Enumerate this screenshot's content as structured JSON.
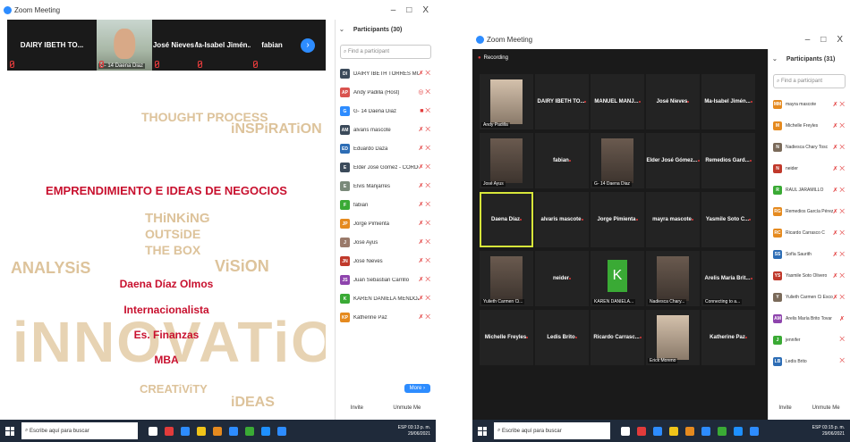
{
  "window_title": "Zoom Meeting",
  "window_controls": [
    "–",
    "□",
    "X"
  ],
  "shot1": {
    "strip": {
      "tiles": [
        {
          "name": "DAIRY IBETH TO...",
          "video": false
        },
        {
          "name": "G- 14 Daena Diaz",
          "video": true
        },
        {
          "name": "José Nieves",
          "video": false
        },
        {
          "name": "Ma-Isabel Jimén...",
          "video": false
        },
        {
          "name": "fabian",
          "video": false
        }
      ],
      "next_icon": "›"
    },
    "slide": {
      "doodles": [
        "THOUGHT PROCESS",
        "iNSPiRATiON",
        "THiNKiNG",
        "OUTSiDE",
        "THE BOX",
        "ANALYSiS",
        "ViSiON",
        "iNNOVATiON",
        "CREATiViTY",
        "iDEAS"
      ],
      "title": "EMPRENDIMIENTO E IDEAS DE NEGOCIOS",
      "lines": [
        "Daena Díaz Olmos",
        "Internacionalista",
        "Es. Finanzas",
        "MBA"
      ]
    },
    "panel": {
      "title": "Participants (30)",
      "chevron": "⌄",
      "search_placeholder": "Find a participant",
      "participants": [
        {
          "initials": "DI",
          "color": "#3b4a5a",
          "name": "DAIRY IBETH TORRES MO... (Me)",
          "icons": "✗ ⨉"
        },
        {
          "initials": "AP",
          "color": "#d9534f",
          "name": "Andy Padilla (Host)",
          "icons": "◎ ⨉"
        },
        {
          "initials": "G",
          "color": "#2d8cff",
          "name": "G- 14 Daena Diaz",
          "icons": "■ ⨉"
        },
        {
          "initials": "AM",
          "color": "#3b4a5a",
          "name": "alvaris mascote",
          "icons": "✗ ⨉"
        },
        {
          "initials": "ED",
          "color": "#2d6db5",
          "name": "Eduardo Daza",
          "icons": "✗ ⨉"
        },
        {
          "initials": "E",
          "color": "#3b4a5a",
          "name": "Elder José Gómez - CORDOBA...",
          "icons": "✗ ⨉"
        },
        {
          "initials": "E",
          "color": "#7a8a7a",
          "name": "Elvis Manjarres",
          "icons": "✗ ⨉"
        },
        {
          "initials": "F",
          "color": "#3aaa35",
          "name": "fabian",
          "icons": "✗ ⨉"
        },
        {
          "initials": "JP",
          "color": "#e58a1f",
          "name": "Jorge Pimienta",
          "icons": "✗ ⨉"
        },
        {
          "initials": "J",
          "color": "#9a7a6a",
          "name": "José Ayus",
          "icons": "✗ ⨉"
        },
        {
          "initials": "JN",
          "color": "#c0392b",
          "name": "José Nieves",
          "icons": "✗ ⨉"
        },
        {
          "initials": "JS",
          "color": "#8e44ad",
          "name": "Juan Sebastian Carrillo",
          "icons": "✗ ⨉"
        },
        {
          "initials": "K",
          "color": "#3aaa35",
          "name": "KAREN DANIELA MENDOZA BE...",
          "icons": "✗ ⨉"
        },
        {
          "initials": "KP",
          "color": "#e58a1f",
          "name": "Katherine Paz",
          "icons": "✗ ⨉"
        }
      ],
      "more_button": "More ›",
      "invite_button": "Invite",
      "unmute_button": "Unmute Me"
    },
    "taskbar": {
      "search_placeholder": "Escribe aquí para buscar",
      "time": "03:13 p. m.",
      "date": "29/06/2021",
      "lang": "ESP"
    }
  },
  "shot2": {
    "top_label": "Recording",
    "tiles": [
      {
        "name": "",
        "label": "Andy Padilla",
        "video": true,
        "col": 0,
        "row": 0
      },
      {
        "name": "DAIRY IBETH TO...",
        "col": 1,
        "row": 0
      },
      {
        "name": "MANUEL MANJ...",
        "col": 2,
        "row": 0
      },
      {
        "name": "José Nieves",
        "col": 3,
        "row": 0
      },
      {
        "name": "Ma-Isabel Jimén...",
        "col": 4,
        "row": 0
      },
      {
        "name": "",
        "label": "José Ayus",
        "video": true,
        "col": 0,
        "row": 1
      },
      {
        "name": "fabian",
        "col": 1,
        "row": 1
      },
      {
        "name": "",
        "label": "G- 14 Daena Diaz",
        "video": true,
        "col": 2,
        "row": 1
      },
      {
        "name": "Elder José Gómez...",
        "col": 3,
        "row": 1
      },
      {
        "name": "Remedios Gard...",
        "col": 4,
        "row": 1
      },
      {
        "name": "Daena Díaz",
        "col": 0,
        "row": 2,
        "active": true
      },
      {
        "name": "alvaris mascote",
        "col": 1,
        "row": 2
      },
      {
        "name": "Jorge Pimienta",
        "col": 2,
        "row": 2
      },
      {
        "name": "mayra mascote",
        "col": 3,
        "row": 2
      },
      {
        "name": "Yasmile Soto C...",
        "col": 4,
        "row": 2
      },
      {
        "name": "",
        "label": "Yulieth Carmen Ci...",
        "video": true,
        "col": 0,
        "row": 3
      },
      {
        "name": "neider",
        "col": 1,
        "row": 3
      },
      {
        "name": "",
        "label": "KAREN DANIELA...",
        "k": "K",
        "col": 2,
        "row": 3
      },
      {
        "name": "",
        "label": "Nadiesca Chary...",
        "video": true,
        "col": 3,
        "row": 3
      },
      {
        "name": "Arelis María Brit...",
        "label": "Connecting to a...",
        "col": 4,
        "row": 3
      },
      {
        "name": "Michelle Freyles",
        "col": 0,
        "row": 4
      },
      {
        "name": "Ledis Brito",
        "col": 1,
        "row": 4
      },
      {
        "name": "Ricardo Carrasc...",
        "col": 2,
        "row": 4
      },
      {
        "name": "",
        "label": "Erick Moreno",
        "video": true,
        "col": 3,
        "row": 4
      },
      {
        "name": "Katherine Paz",
        "col": 4,
        "row": 4
      }
    ],
    "panel": {
      "title": "Participants (31)",
      "chevron": "⌄",
      "search_placeholder": "Find a participant",
      "participants": [
        {
          "initials": "MM",
          "color": "#e58a1f",
          "name": "mayra mascote",
          "icons": "✗ ⨉"
        },
        {
          "initials": "M",
          "color": "#e58a1f",
          "name": "Michelle Freyles",
          "icons": "✗ ⨉"
        },
        {
          "initials": "N",
          "color": "#7a6a5a",
          "name": "Nadiesca Chary Tosc",
          "icons": "✗ ⨉"
        },
        {
          "initials": "N",
          "color": "#c0392b",
          "name": "neider",
          "icons": "✗ ⨉"
        },
        {
          "initials": "R",
          "color": "#3aaa35",
          "name": "RAUL JARAMILLO",
          "icons": "✗ ⨉"
        },
        {
          "initials": "RG",
          "color": "#e58a1f",
          "name": "Remedios García Pérez",
          "icons": "✗ ⨉"
        },
        {
          "initials": "RC",
          "color": "#e58a1f",
          "name": "Ricardo Carrasco C",
          "icons": "✗ ⨉"
        },
        {
          "initials": "SS",
          "color": "#2d6db5",
          "name": "Sofía Saurith",
          "icons": "✗ ⨉"
        },
        {
          "initials": "YS",
          "color": "#c0392b",
          "name": "Yasmile Soto Olivero",
          "icons": "✗ ⨉"
        },
        {
          "initials": "Y",
          "color": "#7a6a5a",
          "name": "Yulieth Carmen Ci Escobar",
          "icons": "✗ ⨉"
        },
        {
          "initials": "AM",
          "color": "#8e44ad",
          "name": "Arelis María Brito Tovar",
          "icons": "✗"
        },
        {
          "initials": "J",
          "color": "#3aaa35",
          "name": "jennifer",
          "icons": "⨉"
        },
        {
          "initials": "LB",
          "color": "#2d6db5",
          "name": "Ledis Brito",
          "icons": "⨉"
        }
      ],
      "invite_button": "Invite",
      "unmute_button": "Unmute Me"
    },
    "taskbar": {
      "search_placeholder": "Escribe aquí para buscar",
      "time": "03:15 p. m.",
      "date": "29/06/2021",
      "lang": "ESP"
    }
  },
  "taskbar_app_colors": [
    "#ffffff",
    "#e23b3b",
    "#2d8cff",
    "#f0c419",
    "#e58a1f",
    "#2d8cff",
    "#3aaa35",
    "#1e90ff",
    "#2d8cff"
  ]
}
